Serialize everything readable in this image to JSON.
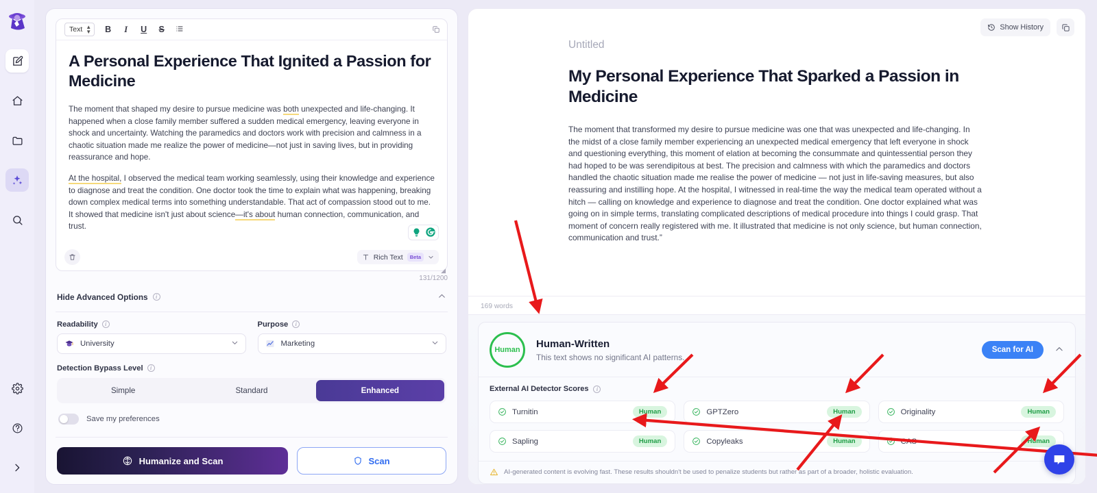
{
  "sidebar": {
    "logo": "detective-logo",
    "items": [
      {
        "name": "edit",
        "icon": "pencil-square-icon"
      },
      {
        "name": "home",
        "icon": "home-icon"
      },
      {
        "name": "folder",
        "icon": "folder-icon"
      },
      {
        "name": "humanizer",
        "icon": "sparkles-icon"
      },
      {
        "name": "search",
        "icon": "search-icon"
      }
    ],
    "bottom_items": [
      {
        "name": "settings",
        "icon": "gear-icon"
      },
      {
        "name": "help",
        "icon": "question-circle-icon"
      },
      {
        "name": "expand",
        "icon": "chevron-right-icon"
      }
    ]
  },
  "editor": {
    "toolbar": {
      "format_value": "Text",
      "bold": "B",
      "italic": "I",
      "underline": "U",
      "strike": "S",
      "list_icon": "bullet-list-icon",
      "copy_icon": "copy-icon"
    },
    "title": "A Personal Experience That Ignited a Passion for Medicine",
    "paragraph1_a": "The moment that shaped my desire to pursue medicine was ",
    "paragraph1_hl": "both",
    "paragraph1_b": " unexpected and life-changing. It happened when a close family member suffered a sudden medical emergency, leaving everyone in shock and uncertainty. Watching the paramedics and doctors work with precision and calmness in a chaotic situation made me realize the power of medicine—not just in saving lives, but in providing reassurance and hope.",
    "paragraph2_hl": "At the hospital,",
    "paragraph2_a": " I observed the medical team working seamlessly, using their knowledge and experience to diagnose and treat the condition. One doctor took the time to explain what was happening, breaking down complex medical terms into something understandable. That act of compassion stood out to me. It showed that medicine isn't just about science",
    "paragraph2_hl2": "—it's about",
    "paragraph2_b": " human connection, communication, and trust.",
    "footer": {
      "trash_icon": "trash-icon",
      "rich_text_label": "Rich Text",
      "rich_text_icon": "text-format-icon",
      "beta_badge": "Beta",
      "chevron": "chevron-down-icon"
    },
    "char_count": "131/1200",
    "assistants": [
      "grammarly-idea-icon",
      "grammarly-logo-icon"
    ]
  },
  "advanced": {
    "toggle_label": "Hide Advanced Options",
    "readability": {
      "label": "Readability",
      "value": "University",
      "icon": "graduation-cap-icon"
    },
    "purpose": {
      "label": "Purpose",
      "value": "Marketing",
      "icon": "chart-line-icon"
    },
    "bypass": {
      "label": "Detection Bypass Level",
      "options": [
        "Simple",
        "Standard",
        "Enhanced"
      ],
      "selected": "Enhanced"
    },
    "save_preferences_label": "Save my preferences",
    "save_preferences_on": false
  },
  "actions": {
    "humanize_label": "Humanize and Scan",
    "humanize_icon": "brain-icon",
    "scan_label": "Scan",
    "scan_icon": "shield-icon"
  },
  "output": {
    "show_history_label": "Show History",
    "show_history_icon": "history-clock-icon",
    "copy_icon": "copy-icon",
    "untitled": "Untitled",
    "title": "My Personal Experience That Sparked a Passion in Medicine",
    "body": "The moment that transformed my desire to pursue medicine was one that was unexpected and life-changing. In the midst of a close family member experiencing an unexpected medical emergency that left everyone in shock and questioning everything, this moment of  elation at becoming the consummate and quintessential person they had hoped to be was serendipitous at best. The precision and calmness with which the paramedics and doctors handled the chaotic situation made me realise the power of medicine —  not just in life-saving measures, but also reassuring and instilling hope. At the  hospital, I witnessed in real-time the way the medical team operated without a hitch — calling on knowledge and experience to diagnose and treat the condition. One doctor explained what was going on in simple terms, translating complicated descriptions of medical procedure into  things I could grasp. That moment of concern really registered with me. It illustrated that medicine is  not only science, but human connection, communication and trust.”",
    "word_count": "169 words"
  },
  "scan": {
    "ring_label": "Human",
    "verdict": "Human-Written",
    "subtext": "This text shows no significant AI patterns.",
    "scan_button": "Scan for AI",
    "collapse_icon": "chevron-up-icon",
    "external_title": "External AI Detector Scores",
    "detectors": [
      {
        "name": "Turnitin",
        "status": "Human"
      },
      {
        "name": "GPTZero",
        "status": "Human"
      },
      {
        "name": "Originality",
        "status": "Human"
      },
      {
        "name": "Sapling",
        "status": "Human"
      },
      {
        "name": "Copyleaks",
        "status": "Human"
      },
      {
        "name": "CAS",
        "status": "Human"
      }
    ],
    "warning_icon": "warning-triangle-icon",
    "warning": "AI-generated content is evolving fast. These results shouldn't be used to penalize students but rather as part of a broader, holistic evaluation."
  },
  "chat": {
    "icon": "chat-bubble-icon"
  },
  "colors": {
    "accent_purple": "#5b3fa8",
    "accent_blue": "#3b82f6",
    "human_green": "#2cbf4e",
    "arrow_red": "#e8191b"
  }
}
